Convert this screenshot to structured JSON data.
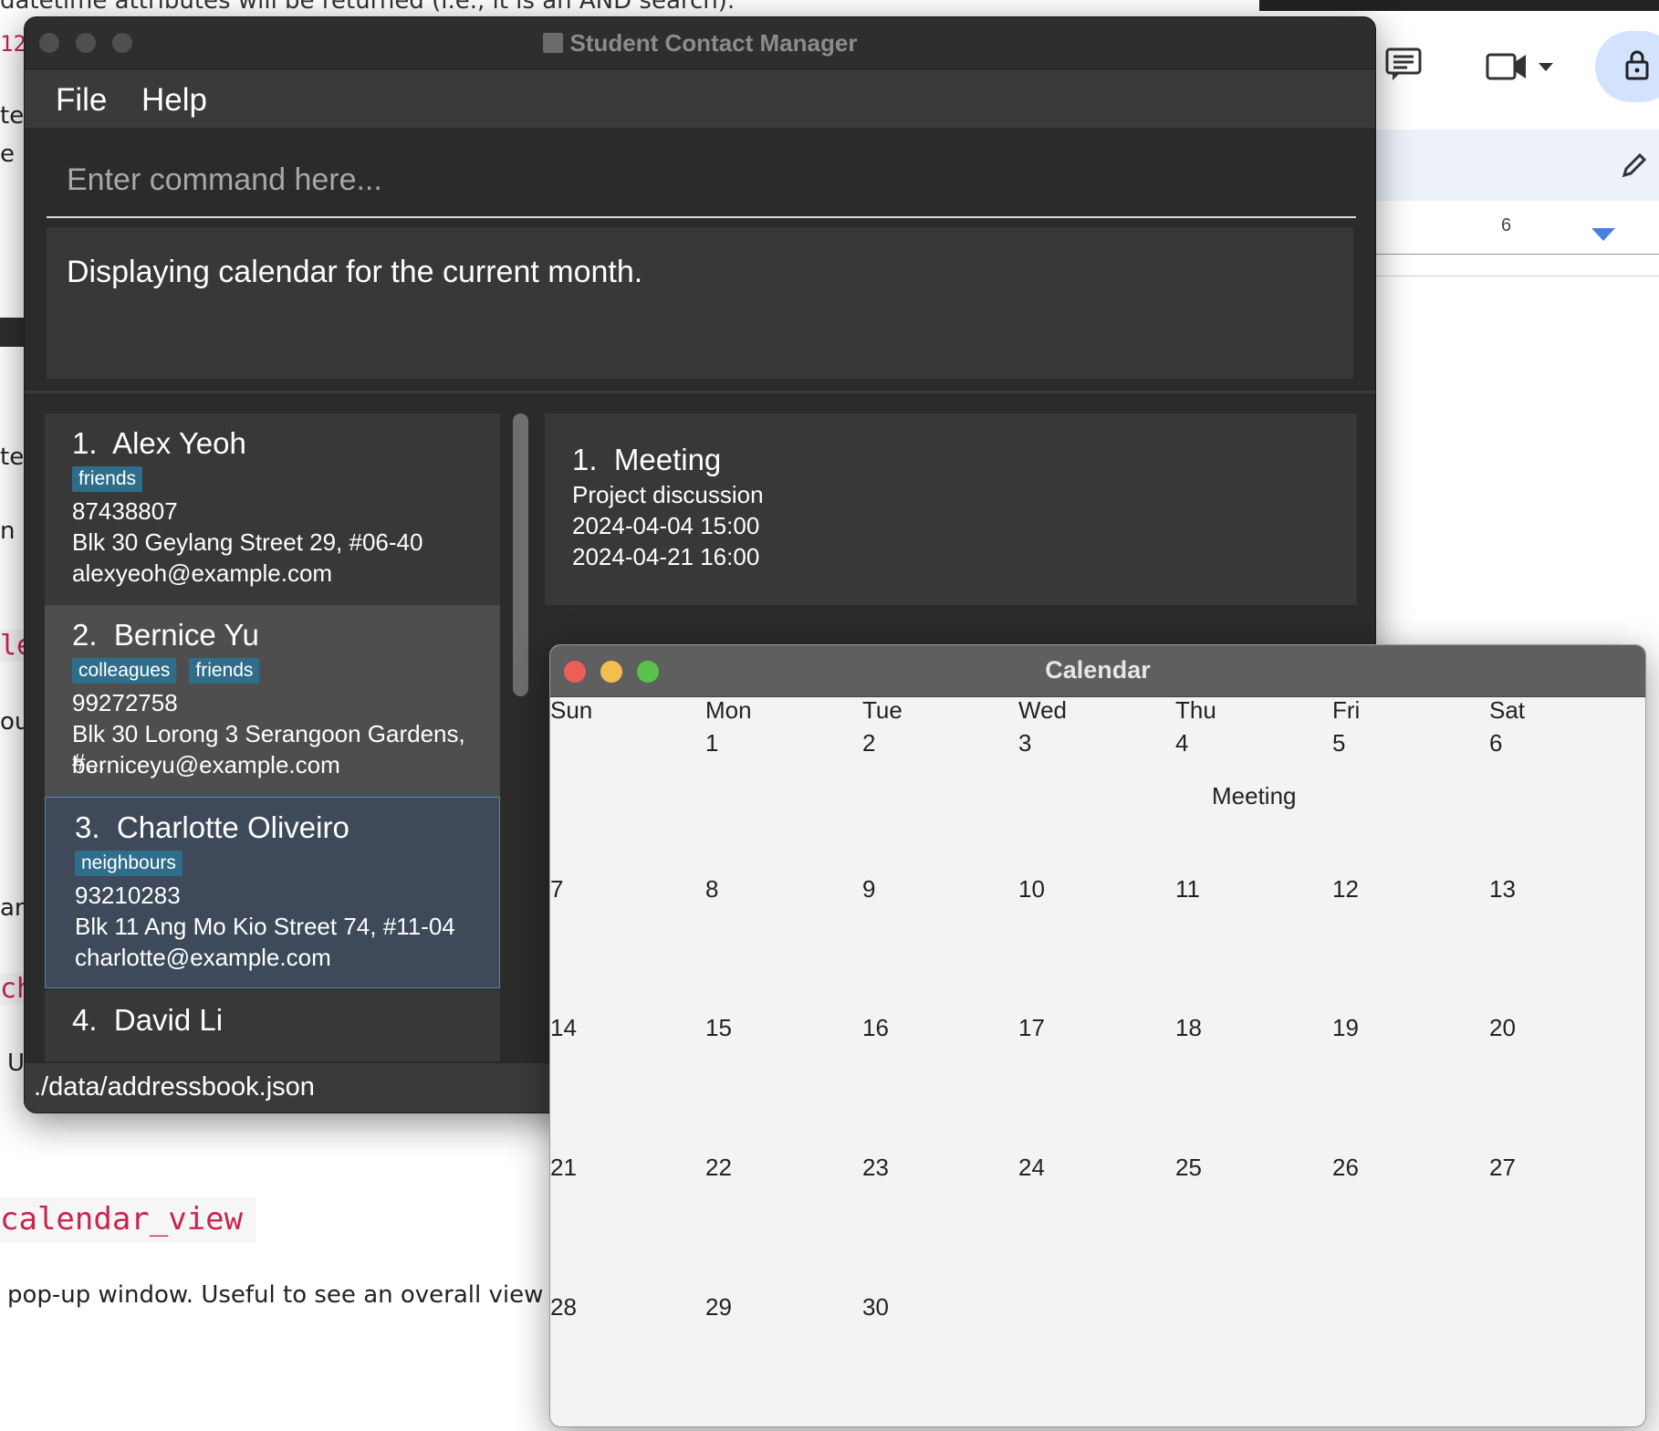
{
  "background_doc": {
    "top_line": "datetime attributes will be returned (i.e., it is an AND search).",
    "top_line_code": "AND",
    "left_number": "12",
    "left_fragments": [
      "te",
      "e i",
      "te",
      "n",
      "ou",
      "an",
      "U"
    ],
    "left_code_fragments": [
      "le",
      "ch"
    ],
    "command_heading": "calendar_view",
    "description": "pop-up window. Useful to see an overall view"
  },
  "background_app": {
    "ruler_number": "6",
    "icons": [
      "comment-icon",
      "video-camera-icon",
      "dropdown-icon",
      "lock-icon",
      "pencil-icon"
    ]
  },
  "main_window": {
    "title": "Student Contact Manager",
    "menu": [
      "File",
      "Help"
    ],
    "command_placeholder": "Enter command here...",
    "result_text": "Displaying calendar for the current month.",
    "status": "./data/addressbook.json",
    "contacts": [
      {
        "index": "1.",
        "name": "Alex Yeoh",
        "tags": [
          "friends"
        ],
        "phone": "87438807",
        "address": "Blk 30 Geylang Street 29, #06-40",
        "email": "alexyeoh@example.com"
      },
      {
        "index": "2.",
        "name": "Bernice Yu",
        "tags": [
          "colleagues",
          "friends"
        ],
        "phone": "99272758",
        "address": "Blk 30 Lorong 3 Serangoon Gardens, #...",
        "email": "berniceyu@example.com"
      },
      {
        "index": "3.",
        "name": "Charlotte Oliveiro",
        "tags": [
          "neighbours"
        ],
        "phone": "93210283",
        "address": "Blk 11 Ang Mo Kio Street 74, #11-04",
        "email": "charlotte@example.com"
      },
      {
        "index": "4.",
        "name": "David Li",
        "tags": [],
        "phone": "",
        "address": "",
        "email": ""
      }
    ],
    "events": [
      {
        "index": "1.",
        "title": "Meeting",
        "description": "Project discussion",
        "start": "2024-04-04 15:00",
        "end": "2024-04-21 16:00"
      }
    ]
  },
  "calendar_window": {
    "title": "Calendar",
    "weekdays": [
      "Sun",
      "Mon",
      "Tue",
      "Wed",
      "Thu",
      "Fri",
      "Sat"
    ],
    "weeks": [
      [
        "",
        "1",
        "2",
        "3",
        "4",
        "5",
        "6"
      ],
      [
        "7",
        "8",
        "9",
        "10",
        "11",
        "12",
        "13"
      ],
      [
        "14",
        "15",
        "16",
        "17",
        "18",
        "19",
        "20"
      ],
      [
        "21",
        "22",
        "23",
        "24",
        "25",
        "26",
        "27"
      ],
      [
        "28",
        "29",
        "30",
        "",
        "",
        "",
        ""
      ]
    ],
    "event_label": "Meeting",
    "traffic_light_colors": [
      "#ec5f57",
      "#f4bd4f",
      "#5ac24d"
    ]
  }
}
